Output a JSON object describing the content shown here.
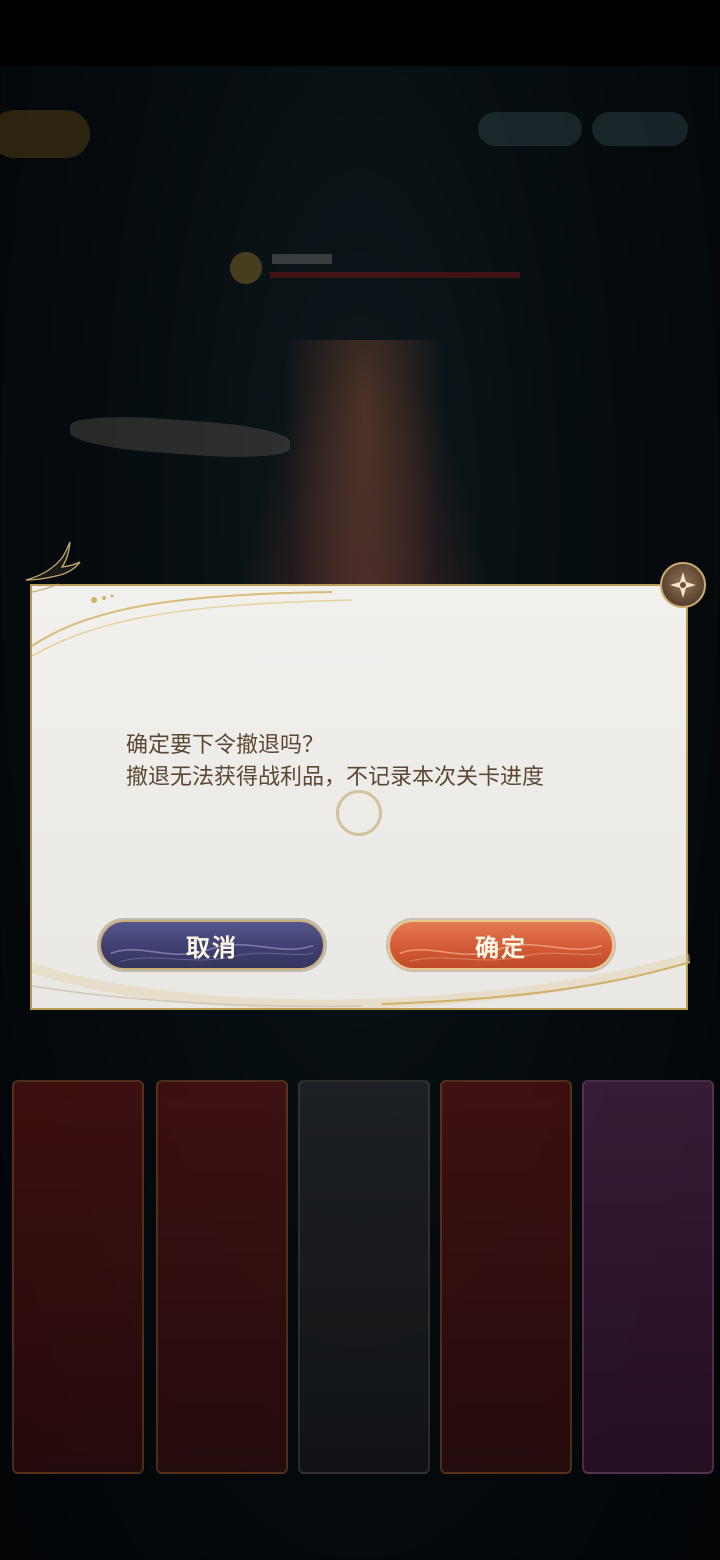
{
  "dialog": {
    "message_line1": "确定要下令撤退吗？",
    "message_line2": "撤退无法获得战利品，不记录本次关卡进度",
    "cancel_label": "取消",
    "confirm_label": "确定"
  },
  "colors": {
    "dialog_background": "#f1f0ed",
    "dialog_border": "#b99a55",
    "message_text": "#5b4732",
    "cancel_button": "#3f4070",
    "confirm_button": "#d45a36"
  },
  "icons": {
    "close": "close-icon",
    "loading": "loading-spinner-icon",
    "decoration": "swallow-bird-icon"
  }
}
